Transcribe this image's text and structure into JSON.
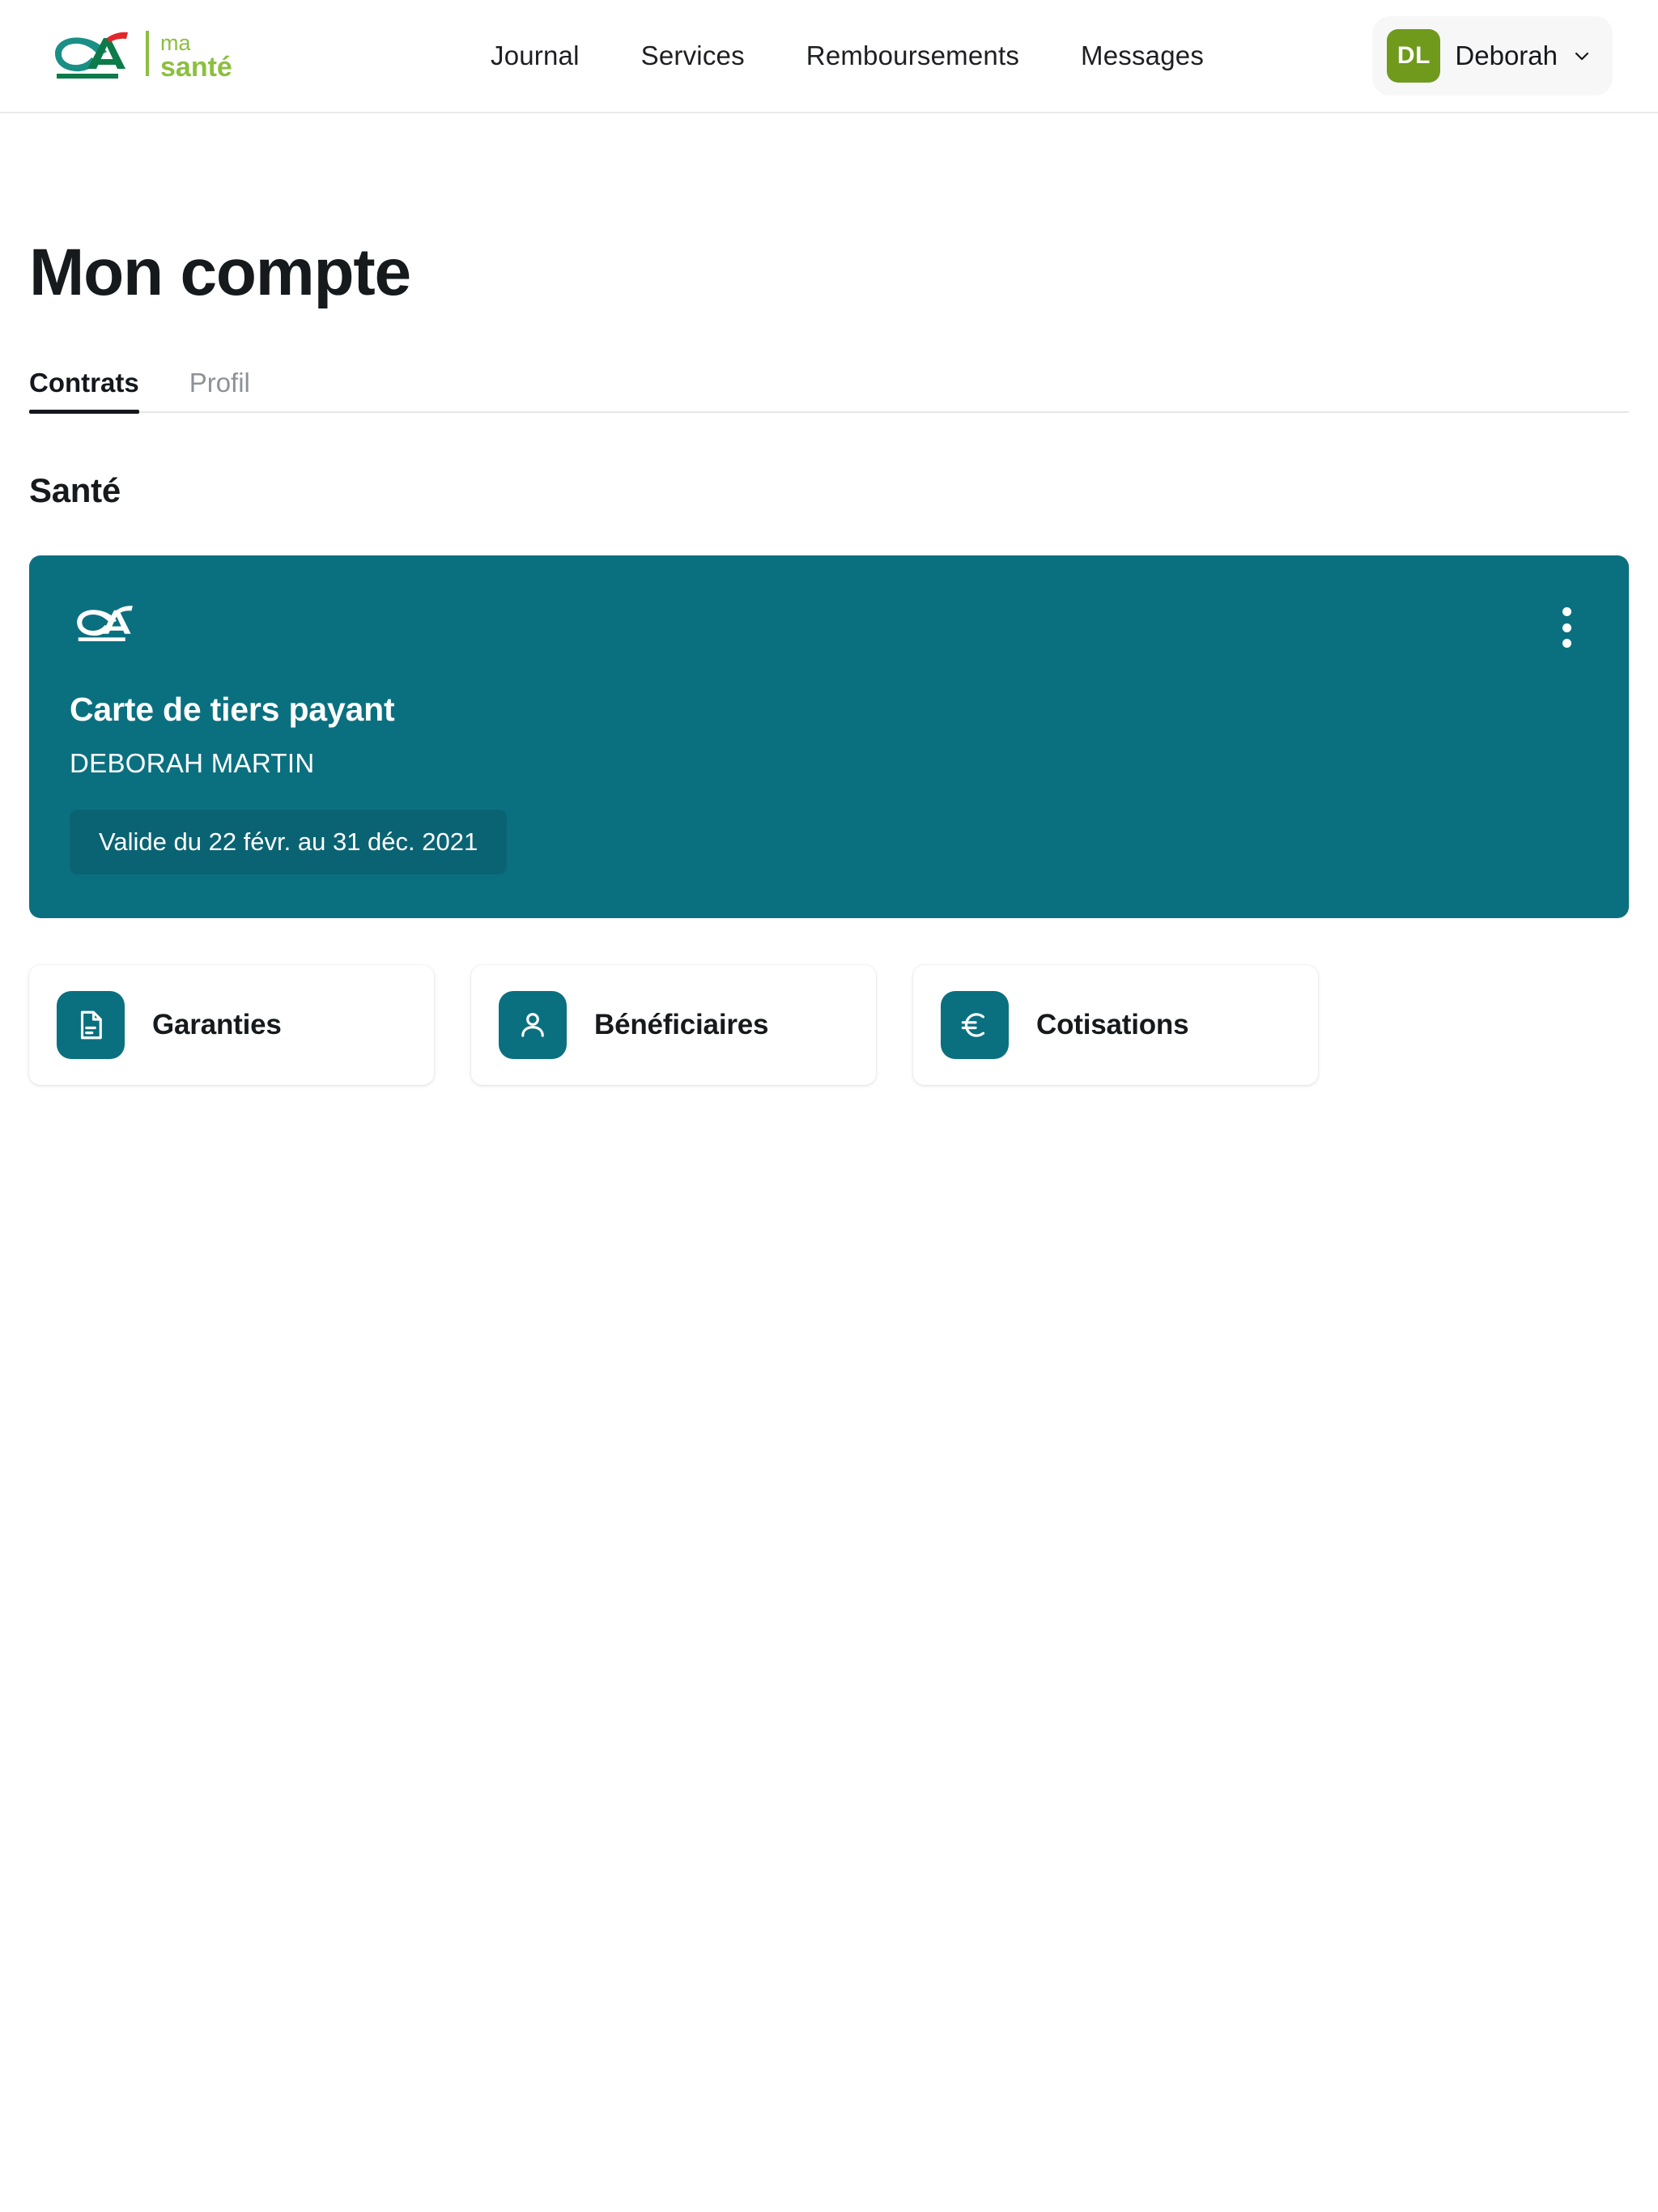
{
  "header": {
    "brand": {
      "logo_icon": "credit-agricole-logo",
      "wordmark_line1": "ma",
      "wordmark_line2": "santé"
    },
    "nav": [
      {
        "label": "Journal",
        "icon": "journal-nav-item"
      },
      {
        "label": "Services",
        "icon": "services-nav-item"
      },
      {
        "label": "Remboursements",
        "icon": "remboursements-nav-item"
      },
      {
        "label": "Messages",
        "icon": "messages-nav-item"
      }
    ],
    "user": {
      "initials": "DL",
      "name": "Deborah",
      "chevron_icon": "chevron-down-icon",
      "avatar_color": "#6f9a1c"
    }
  },
  "main": {
    "page_title": "Mon compte",
    "tabs": [
      {
        "label": "Contrats",
        "active": true
      },
      {
        "label": "Profil",
        "active": false
      }
    ],
    "section_title": "Santé",
    "contract_card": {
      "logo_icon": "credit-agricole-logo-white",
      "menu_icon": "kebab-menu-icon",
      "title": "Carte de tiers payant",
      "holder": "DEBORAH MARTIN",
      "validity": "Valide du 22 févr. au 31 déc. 2021",
      "background_color": "#0a7080",
      "badge_color": "#0a6373"
    },
    "actions": [
      {
        "label": "Garanties",
        "icon": "document-icon"
      },
      {
        "label": "Bénéficiaires",
        "icon": "person-icon"
      },
      {
        "label": "Cotisations",
        "icon": "euro-icon"
      }
    ]
  },
  "theme": {
    "teal": "#0a7080",
    "teal_dark": "#0a6373",
    "green": "#6f9a1c",
    "text_dark": "#161a1d",
    "text_muted": "#8e9196"
  }
}
